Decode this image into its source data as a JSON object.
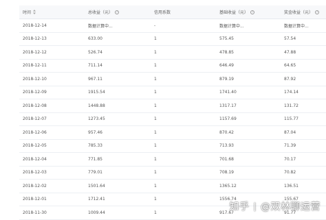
{
  "headers": {
    "time": "时间",
    "total": "总收益（元）",
    "credit": "信用系数",
    "base": "基础收益（元）",
    "bonus": "奖金收益（元）"
  },
  "icons": {
    "sort": "sort-icon",
    "info": "info-icon"
  },
  "rows": [
    {
      "date": "2018-12-14",
      "total": "数据计算中...",
      "credit": "-",
      "base": "数据计算中...",
      "bonus": "数据计算中..."
    },
    {
      "date": "2018-12-13",
      "total": "633.00",
      "credit": "1",
      "base": "575.45",
      "bonus": "57.54"
    },
    {
      "date": "2018-12-12",
      "total": "526.74",
      "credit": "1",
      "base": "478.85",
      "bonus": "47.88"
    },
    {
      "date": "2018-12-11",
      "total": "711.14",
      "credit": "1",
      "base": "646.49",
      "bonus": "64.65"
    },
    {
      "date": "2018-12-10",
      "total": "967.11",
      "credit": "1",
      "base": "879.19",
      "bonus": "87.92"
    },
    {
      "date": "2018-12-09",
      "total": "1915.54",
      "credit": "1",
      "base": "1741.40",
      "bonus": "174.14"
    },
    {
      "date": "2018-12-08",
      "total": "1448.88",
      "credit": "1",
      "base": "1317.17",
      "bonus": "131.72"
    },
    {
      "date": "2018-12-07",
      "total": "1273.45",
      "credit": "1",
      "base": "1157.69",
      "bonus": "115.77"
    },
    {
      "date": "2018-12-06",
      "total": "957.46",
      "credit": "1",
      "base": "870.42",
      "bonus": "87.04"
    },
    {
      "date": "2018-12-05",
      "total": "785.33",
      "credit": "1",
      "base": "713.93",
      "bonus": "71.39"
    },
    {
      "date": "2018-12-04",
      "total": "771.85",
      "credit": "1",
      "base": "701.68",
      "bonus": "70.17"
    },
    {
      "date": "2018-12-03",
      "total": "779.01",
      "credit": "1",
      "base": "708.19",
      "bonus": "70.82"
    },
    {
      "date": "2018-12-02",
      "total": "1501.64",
      "credit": "1",
      "base": "1365.12",
      "bonus": "136.51"
    },
    {
      "date": "2018-12-01",
      "total": "1712.41",
      "credit": "1",
      "base": "1556.74",
      "bonus": "155.67"
    },
    {
      "date": "2018-11-30",
      "total": "1009.44",
      "credit": "1",
      "base": "917.67",
      "bonus": "91.77"
    }
  ],
  "watermark": {
    "site": "知乎",
    "author": "@双林聊运营"
  },
  "colors": {
    "header_bg": "#f7f8fa",
    "row_border": "#eceff3",
    "text": "#555555"
  }
}
